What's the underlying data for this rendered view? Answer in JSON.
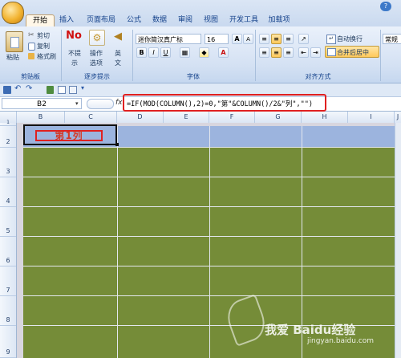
{
  "tabs": [
    "开始",
    "插入",
    "页面布局",
    "公式",
    "数据",
    "审阅",
    "视图",
    "开发工具",
    "加载项"
  ],
  "active_tab": 0,
  "clipboard": {
    "paste": "粘贴",
    "cut": "剪切",
    "copy": "复制",
    "format_painter": "格式刷",
    "group_label": "剪贴板"
  },
  "step_tips": {
    "no_line1": "不提",
    "no_line2": "示",
    "op_line1": "操作",
    "op_line2": "选项",
    "eng_line1": "英",
    "eng_line2": "文",
    "group_label": "逐步提示"
  },
  "font": {
    "name": "迷你简汉真广标",
    "size": "16",
    "group_label": "字体"
  },
  "alignment": {
    "wrap_text": "自动换行",
    "merge_center": "合并后居中",
    "group_label": "对齐方式"
  },
  "number": {
    "format": "常规"
  },
  "formula_bar": {
    "name_box": "B2",
    "fx": "fx",
    "formula": "=IF(MOD(COLUMN(),2)=0,\"第\"&COLUMN()/2&\"列\",\"\")"
  },
  "columns": [
    "B",
    "C",
    "D",
    "E",
    "F",
    "G",
    "H",
    "I",
    "J"
  ],
  "rows": [
    "1",
    "2",
    "3",
    "4",
    "5",
    "6",
    "7",
    "8",
    "9"
  ],
  "cell_b2": "第1列",
  "colors": {
    "header_fill": "#9cb4de",
    "body_fill": "#758c38",
    "highlight_outline": "#e02020",
    "cell_text": "#d43a28"
  },
  "watermark": {
    "line1": "我爱  Baidu经验",
    "line2": "jingyan.baidu.com"
  }
}
